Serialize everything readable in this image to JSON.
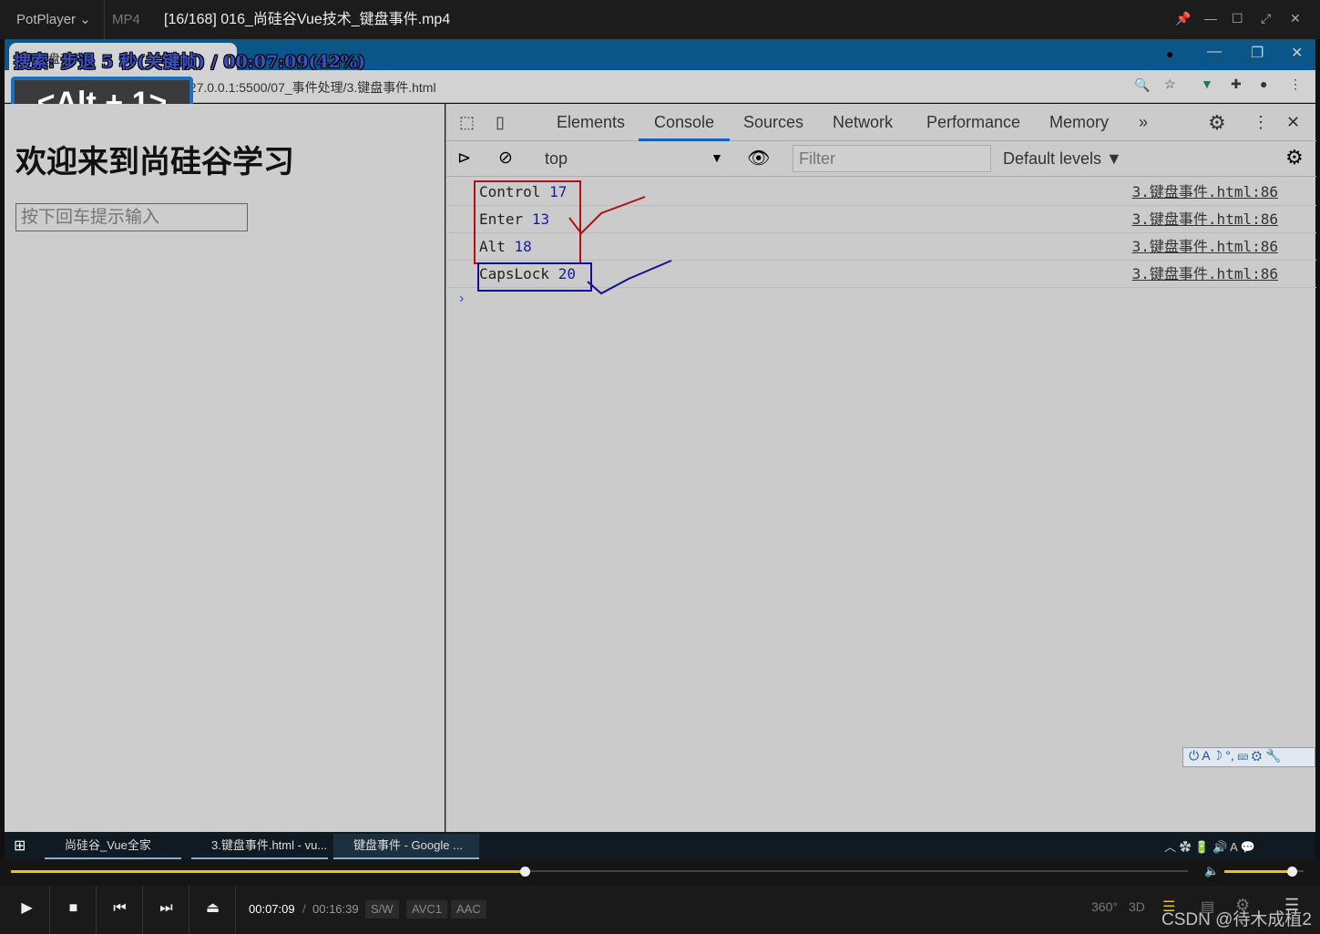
{
  "player": {
    "brand": "PotPlayer",
    "format": "MP4",
    "title": "[16/168] 016_尚硅谷Vue技术_键盘事件.mp4",
    "osd": "搜索: 步退 5 秒(关键帧) / 00:07:09(42%)",
    "hotkey": "<Alt + 1>",
    "time_current": "00:07:09",
    "time_total": "00:16:39",
    "badges": [
      "S/W",
      "AVC1",
      "AAC"
    ],
    "progress_percent": 42,
    "volume_percent": 85,
    "right_icons": [
      "360°",
      "3D"
    ],
    "watermark": "CSDN @待木成植2"
  },
  "browser": {
    "tab_title": "键盘事件",
    "url": "127.0.0.1:5500/07_事件处理/3.键盘事件.html"
  },
  "page": {
    "heading": "欢迎来到尚硅谷学习",
    "input_placeholder": "按下回车提示输入"
  },
  "devtools": {
    "tabs": [
      "Elements",
      "Console",
      "Sources",
      "Network",
      "Performance",
      "Memory"
    ],
    "active_tab": "Console",
    "context": "top",
    "filter_placeholder": "Filter",
    "levels": "Default levels ▼",
    "logs": [
      {
        "key": "Control",
        "code": "17",
        "source": "3.键盘事件.html:86"
      },
      {
        "key": "Enter",
        "code": "13",
        "source": "3.键盘事件.html:86"
      },
      {
        "key": "Alt",
        "code": "18",
        "source": "3.键盘事件.html:86"
      },
      {
        "key": "CapsLock",
        "code": "20",
        "source": "3.键盘事件.html:86"
      }
    ]
  },
  "taskbar": {
    "items": [
      "尚硅谷_Vue全家桶.d...",
      "3.键盘事件.html - vu...",
      "键盘事件 - Google ..."
    ]
  },
  "colors": {
    "annotation_red": "#b01010",
    "annotation_blue": "#101090",
    "progress": "#e8c800"
  }
}
